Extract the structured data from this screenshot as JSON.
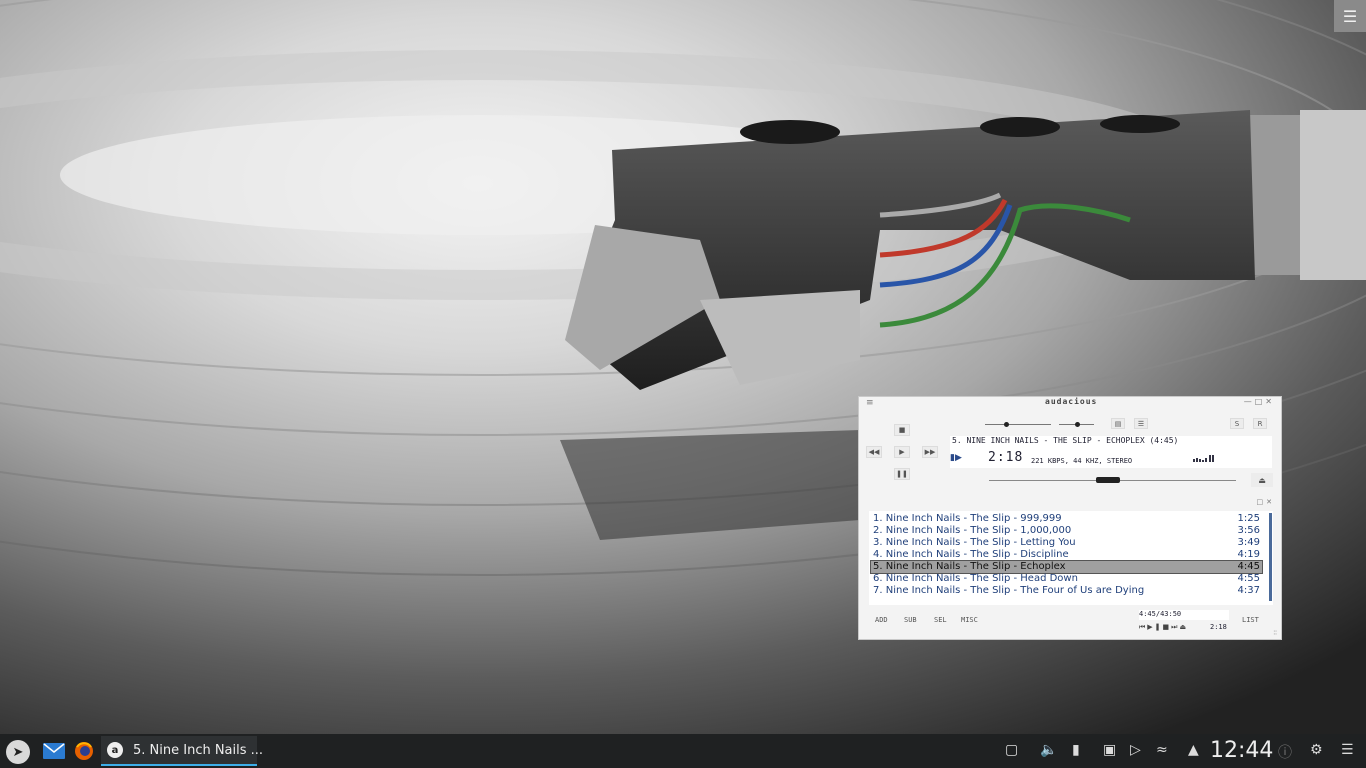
{
  "player": {
    "logo": "audacious",
    "now_playing_title": "5. NINE INCH NAILS - THE SLIP - ECHOPLEX (4:45)",
    "elapsed_time": "2:18",
    "stream_info": "221 KBPS, 44 KHZ, STEREO",
    "seek_position_fraction": 0.48,
    "volume_fraction": 0.32,
    "balance_fraction": 0.5
  },
  "playlist": {
    "items": [
      {
        "title": "1. Nine Inch Nails - The Slip - 999,999",
        "duration": "1:25"
      },
      {
        "title": "2. Nine Inch Nails - The Slip - 1,000,000",
        "duration": "3:56"
      },
      {
        "title": "3. Nine Inch Nails - The Slip - Letting You",
        "duration": "3:49"
      },
      {
        "title": "4. Nine Inch Nails - The Slip - Discipline",
        "duration": "4:19"
      },
      {
        "title": "5. Nine Inch Nails - The Slip - Echoplex",
        "duration": "4:45"
      },
      {
        "title": "6. Nine Inch Nails - The Slip - Head Down",
        "duration": "4:55"
      },
      {
        "title": "7. Nine Inch Nails - The Slip - The Four of Us are Dying",
        "duration": "4:37"
      }
    ],
    "selected_index": 4,
    "buttons": {
      "add": "ADD",
      "sub": "SUB",
      "sel": "SEL",
      "misc": "MISC",
      "list": "LIST"
    },
    "total_time": "4:45/43:50",
    "mini_time": "2:18"
  },
  "taskbar": {
    "active_task_label": "5. Nine Inch Nails ...",
    "active_task_icon_letter": "a",
    "clock": "12:44"
  },
  "colors": {
    "taskbar_bg": "#1f2122",
    "task_underline": "#3daee9",
    "playlist_text": "#1f3f7a",
    "selected_row": "#a0a0a0"
  }
}
